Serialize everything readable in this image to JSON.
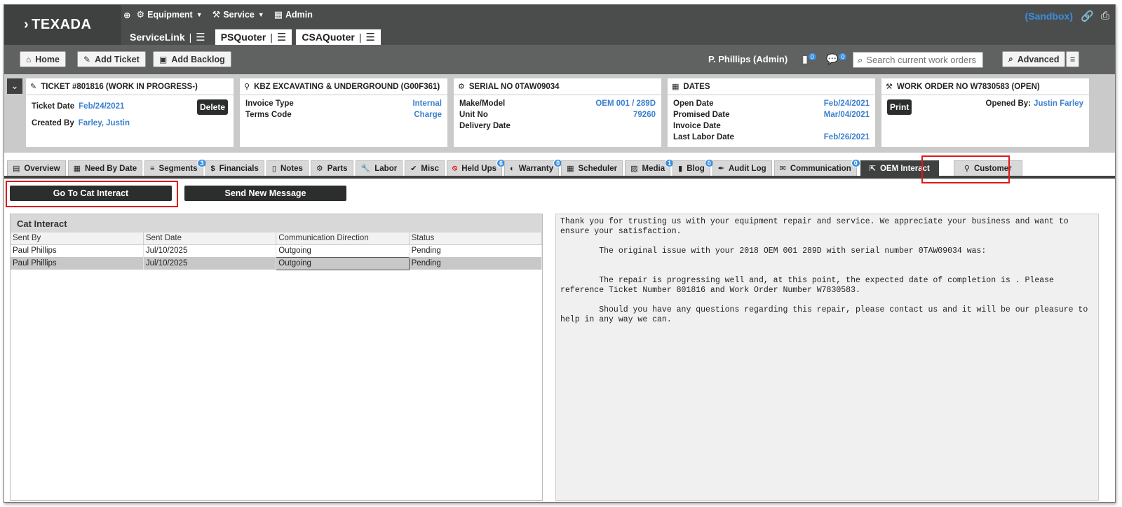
{
  "app": {
    "brand": "TEXADA",
    "nav": [
      "Equipment",
      "Service",
      "Admin"
    ],
    "app_tabs": [
      "ServiceLink",
      "PSQuoter",
      "CSAQuoter"
    ],
    "environment": "(Sandbox)"
  },
  "toolbar": {
    "home": "Home",
    "add_ticket": "Add Ticket",
    "add_backlog": "Add Backlog",
    "user": "P. Phillips (Admin)",
    "badge1": "0",
    "badge2": "0",
    "search_placeholder": "Search current work orders",
    "advanced": "Advanced"
  },
  "cards": {
    "ticket": {
      "title": "TICKET #801816 (WORK IN PROGRESS-)",
      "ticket_date_label": "Ticket Date",
      "ticket_date": "Feb/24/2021",
      "created_by_label": "Created By",
      "created_by": "Farley, Justin",
      "delete": "Delete"
    },
    "customer": {
      "title": "KBZ EXCAVATING & UNDERGROUND (G00F361)",
      "invoice_type_label": "Invoice Type",
      "invoice_type": "Internal",
      "terms_code_label": "Terms Code",
      "terms_code": "Charge"
    },
    "serial": {
      "title": "SERIAL NO 0TAW09034",
      "make_model_label": "Make/Model",
      "make_model": "OEM 001 / 289D",
      "unit_no_label": "Unit No",
      "unit_no": "79260",
      "delivery_date_label": "Delivery Date"
    },
    "dates": {
      "title": "DATES",
      "open_date_label": "Open Date",
      "open_date": "Feb/24/2021",
      "promised_date_label": "Promised Date",
      "promised_date": "Mar/04/2021",
      "invoice_date_label": "Invoice Date",
      "last_labor_date_label": "Last Labor Date",
      "last_labor_date": "Feb/26/2021"
    },
    "work_order": {
      "title": "WORK ORDER NO W7830583 (OPEN)",
      "print": "Print",
      "opened_by_label": "Opened By:",
      "opened_by": "Justin Farley"
    }
  },
  "tabs": [
    {
      "label": "Overview"
    },
    {
      "label": "Need By Date"
    },
    {
      "label": "Segments",
      "badge": "3"
    },
    {
      "label": "Financials"
    },
    {
      "label": "Notes"
    },
    {
      "label": "Parts"
    },
    {
      "label": "Labor"
    },
    {
      "label": "Misc"
    },
    {
      "label": "Held Ups",
      "badge": "6"
    },
    {
      "label": "Warranty",
      "badge": "0"
    },
    {
      "label": "Scheduler"
    },
    {
      "label": "Media",
      "badge": "1"
    },
    {
      "label": "Blog",
      "badge": "0"
    },
    {
      "label": "Audit Log"
    },
    {
      "label": "Communication",
      "badge": "0"
    },
    {
      "label": "OEM Interact"
    },
    {
      "label": "Customer"
    }
  ],
  "actions": {
    "go_to": "Go To Cat Interact",
    "send": "Send New Message"
  },
  "cat_interact": {
    "title": "Cat Interact",
    "columns": [
      "Sent By",
      "Sent Date",
      "Communication Direction",
      "Status"
    ],
    "rows": [
      [
        "Paul Phillips",
        "Jul/10/2025",
        "Outgoing",
        "Pending"
      ],
      [
        "Paul Phillips",
        "Jul/10/2025",
        "Outgoing",
        "Pending"
      ]
    ]
  },
  "message": {
    "p1": "Thank you for trusting us with your equipment repair and service. We appreciate your business and want to ensure your satisfaction.",
    "p2": "        The original issue with your 2018 OEM 001 289D with serial number 0TAW09034 was:",
    "p3": "        The repair is progressing well and, at this point, the expected date of completion is . Please reference Ticket Number 801816 and Work Order Number W7830583.",
    "p4": "        Should you have any questions regarding this repair, please contact us and it will be our pleasure to help in any way we can."
  }
}
